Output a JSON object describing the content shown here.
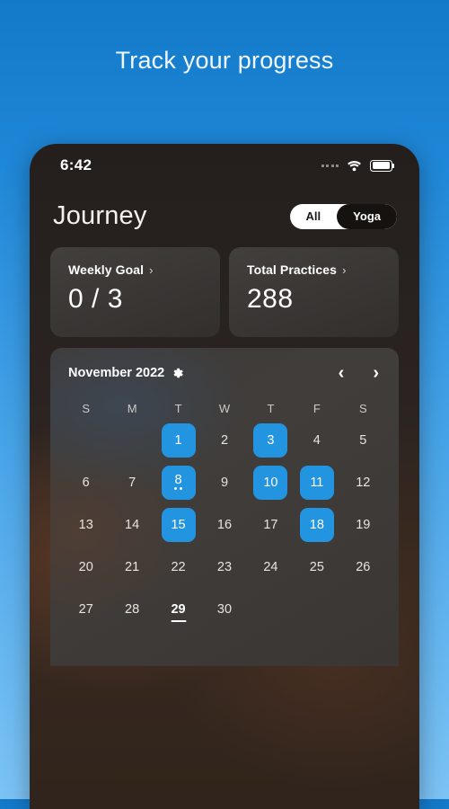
{
  "headline": "Track your progress",
  "status_bar": {
    "time": "6:42",
    "signal_icon": "signal-dots-icon",
    "wifi_icon": "wifi-icon",
    "battery_icon": "battery-icon"
  },
  "header": {
    "app_title": "Journey",
    "segmented": {
      "options": [
        {
          "label": "All",
          "selected": false
        },
        {
          "label": "Yoga",
          "selected": true
        }
      ]
    }
  },
  "cards": [
    {
      "label": "Weekly Goal",
      "chevron": "›",
      "value": "0 / 3"
    },
    {
      "label": "Total Practices",
      "chevron": "›",
      "value": "288"
    }
  ],
  "calendar": {
    "month_label": "November 2022",
    "settings_icon": "gear-icon",
    "prev_icon": "chevron-left-icon",
    "next_icon": "chevron-right-icon",
    "prev_glyph": "‹",
    "next_glyph": "›",
    "weekdays": [
      "S",
      "M",
      "T",
      "W",
      "T",
      "F",
      "S"
    ],
    "weeks": [
      [
        {
          "day": ""
        },
        {
          "day": ""
        },
        {
          "day": "1",
          "marked": true
        },
        {
          "day": "2"
        },
        {
          "day": "3",
          "marked": true
        },
        {
          "day": "4"
        },
        {
          "day": "5"
        }
      ],
      [
        {
          "day": "6"
        },
        {
          "day": "7"
        },
        {
          "day": "8",
          "marked": true,
          "dots": 2
        },
        {
          "day": "9"
        },
        {
          "day": "10",
          "marked": true
        },
        {
          "day": "11",
          "marked": true
        },
        {
          "day": "12"
        }
      ],
      [
        {
          "day": "13"
        },
        {
          "day": "14"
        },
        {
          "day": "15",
          "marked": true
        },
        {
          "day": "16"
        },
        {
          "day": "17"
        },
        {
          "day": "18",
          "marked": true
        },
        {
          "day": "19"
        }
      ],
      [
        {
          "day": "20"
        },
        {
          "day": "21"
        },
        {
          "day": "22"
        },
        {
          "day": "23"
        },
        {
          "day": "24"
        },
        {
          "day": "25"
        },
        {
          "day": "26"
        }
      ],
      [
        {
          "day": "27"
        },
        {
          "day": "28"
        },
        {
          "day": "29",
          "today": true
        },
        {
          "day": "30"
        },
        {
          "day": ""
        },
        {
          "day": ""
        },
        {
          "day": ""
        }
      ]
    ]
  },
  "colors": {
    "accent_blue": "#2394e0",
    "background_top": "#1379c9",
    "background_bottom": "#7cc3f5",
    "card_bg": "#3a3734",
    "phone_bg": "#2a2321"
  }
}
